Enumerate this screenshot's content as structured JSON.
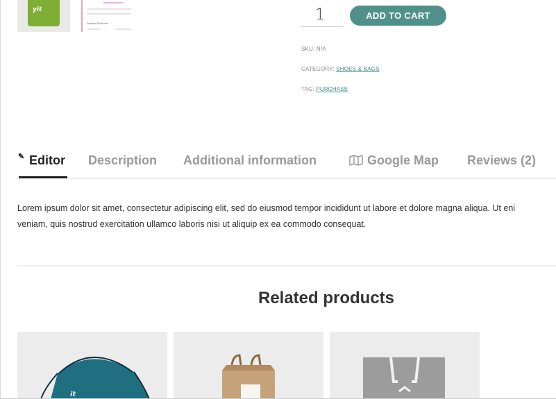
{
  "thumbnails": {
    "first_logo": "yit",
    "second_heading": "Related Products"
  },
  "quantity": {
    "value": "1"
  },
  "add_to_cart": {
    "label": "ADD TO CART"
  },
  "meta": {
    "sku_label": "SKU:",
    "sku_value": "N/A",
    "category_label": "CATEGORY:",
    "category_value": "SHOES & BAGS",
    "tag_label": "TAG:",
    "tag_value": "PURCHASE"
  },
  "tabs": [
    {
      "label": "Editor",
      "icon": "pencil-icon",
      "active": true
    },
    {
      "label": "Description",
      "active": false
    },
    {
      "label": "Additional information",
      "active": false
    },
    {
      "label": "Google Map",
      "icon": "map-icon",
      "active": false
    },
    {
      "label": "Reviews (2)",
      "active": false
    }
  ],
  "description": {
    "line1": "Lorem ipsum dolor sit amet, consectetur adipiscing elit, sed do eiusmod tempor incididunt ut labore et dolore magna aliqua. Ut eni",
    "line2": "veniam, quis nostrud exercitation ullamco laboris nisi ut aliquip ex ea commodo consequat."
  },
  "related": {
    "title": "Related products",
    "products": [
      {
        "image": "teal-drawstring-bag",
        "logo": "it"
      },
      {
        "image": "kraft-paper-bag"
      },
      {
        "image": "grey-tote-bag"
      }
    ]
  },
  "colors": {
    "accent": "#4f918a",
    "link": "#3f8f86",
    "bag_green": "#7fae35",
    "teal_bag": "#1f6f80"
  }
}
